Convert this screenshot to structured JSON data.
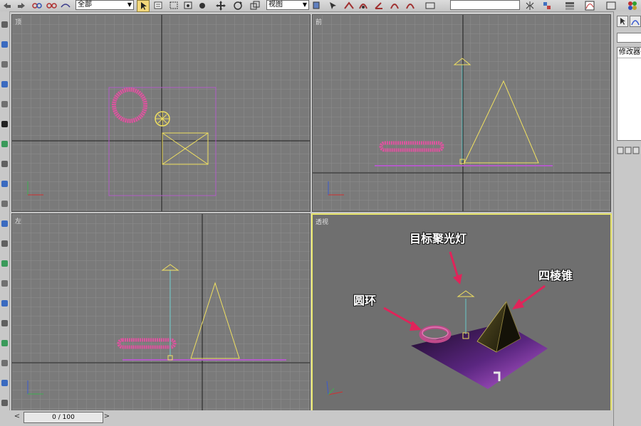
{
  "toolbar": {
    "selection_filter": "全部",
    "coord_system": "视图",
    "icons": [
      "select-icon",
      "select-by-name-icon",
      "rect-region-icon",
      "window-crossing-icon",
      "move-icon",
      "rotate-icon",
      "scale-icon",
      "mirror-icon",
      "align-icon",
      "snap-icon",
      "angle-snap-icon",
      "percent-snap-icon",
      "spinner-snap-icon",
      "material-icon",
      "render-icon"
    ]
  },
  "viewports": {
    "top": {
      "label": "顶"
    },
    "front": {
      "label": "前"
    },
    "left": {
      "label": "左"
    },
    "perspective": {
      "label": "透视"
    }
  },
  "right_panel": {
    "modifier_list_label": "修改器列表"
  },
  "timeline": {
    "value": "0 / 100",
    "prev_arrow": "<",
    "next_arrow": ">"
  },
  "annotations": {
    "spotlight": "目标聚光灯",
    "pyramid": "四棱锥",
    "torus": "圆环"
  },
  "colors": {
    "viewport_bg": "#7a7a7a",
    "grid": "#8c8c8c",
    "grid_axis": "#1e1e1e",
    "active_border": "#e7e46a",
    "torus": "#e052a0",
    "light": "#f0e060",
    "plane": "#b25cc8",
    "annotation_arrow": "#e0245a"
  }
}
